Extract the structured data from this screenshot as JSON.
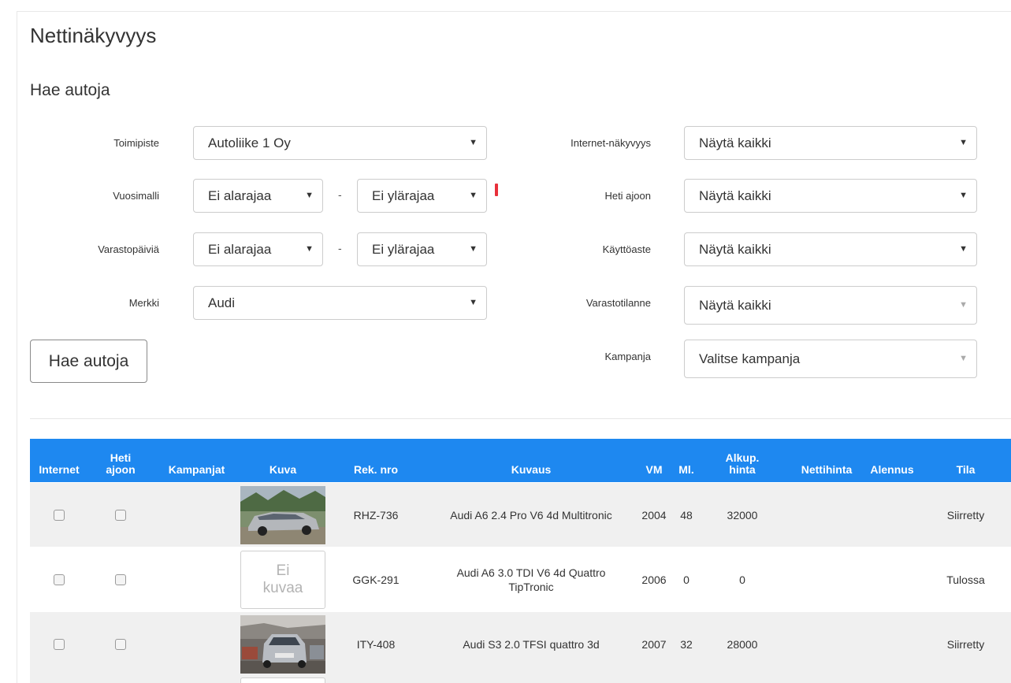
{
  "page": {
    "title": "Nettinäkyvyys",
    "section_title": "Hae autoja"
  },
  "filters": {
    "toimipiste": {
      "label": "Toimipiste",
      "value": "Autoliike 1 Oy"
    },
    "vuosimalli": {
      "label": "Vuosimalli",
      "min": "Ei alarajaa",
      "max": "Ei ylärajaa",
      "separator": "-"
    },
    "varastopaivia": {
      "label": "Varastopäiviä",
      "min": "Ei alarajaa",
      "max": "Ei ylärajaa",
      "separator": "-"
    },
    "merkki": {
      "label": "Merkki",
      "value": "Audi"
    },
    "internet_nakyvyys": {
      "label": "Internet-näkyvyys",
      "value": "Näytä kaikki"
    },
    "heti_ajoon": {
      "label": "Heti ajoon",
      "value": "Näytä kaikki"
    },
    "kayttoaste": {
      "label": "Käyttöaste",
      "value": "Näytä kaikki"
    },
    "varastotilanne": {
      "label": "Varastotilanne",
      "value": "Näytä kaikki"
    },
    "kampanja": {
      "label": "Kampanja",
      "value": "Valitse kampanja"
    }
  },
  "search_button": "Hae autoja",
  "table": {
    "headers": {
      "internet": "Internet",
      "heti1": "Heti",
      "heti2": "ajoon",
      "kampanjat": "Kampanjat",
      "kuva": "Kuva",
      "rek": "Rek. nro",
      "kuvaus": "Kuvaus",
      "vm": "VM",
      "ml": "Ml.",
      "alkup1": "Alkup.",
      "alkup2": "hinta",
      "nettihinta": "Nettihinta",
      "alennus": "Alennus",
      "tila": "Tila"
    },
    "rows": [
      {
        "rek": "RHZ-736",
        "kuvaus": "Audi A6 2.4 Pro V6 4d Multitronic",
        "vm": "2004",
        "ml": "48",
        "alkup": "32000",
        "tila": "Siirretty",
        "image": "silver-wagon"
      },
      {
        "rek": "GGK-291",
        "kuvaus1": "Audi A6 3.0 TDI V6 4d Quattro",
        "kuvaus2": "TipTronic",
        "vm": "2006",
        "ml": "0",
        "alkup": "0",
        "tila": "Tulossa",
        "no_image1": "Ei",
        "no_image2": "kuvaa"
      },
      {
        "rek": "ITY-408",
        "kuvaus": "Audi S3 2.0 TFSI quattro 3d",
        "vm": "2007",
        "ml": "32",
        "alkup": "28000",
        "tila": "Siirretty",
        "image": "silver-hatch"
      }
    ]
  },
  "colors": {
    "header_bg": "#1e88f0",
    "row_alt": "#f0f0f0",
    "marker": "#e8303a"
  }
}
